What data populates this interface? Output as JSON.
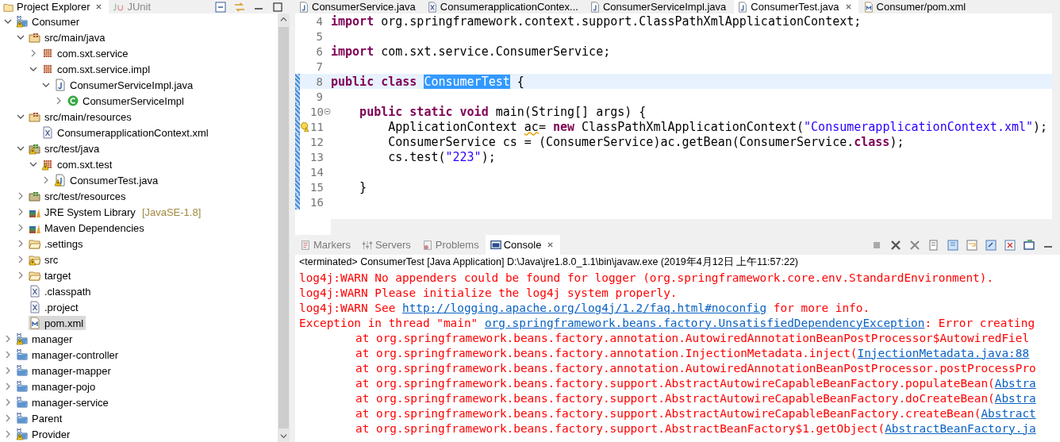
{
  "explorer": {
    "tabs": [
      {
        "label": "Project Explorer",
        "selected": true,
        "kind": "explorer"
      },
      {
        "label": "JUnit",
        "selected": false,
        "kind": "junit"
      }
    ],
    "tree": [
      {
        "label": "Consumer",
        "kind": "project",
        "expanded": true,
        "warning": true,
        "selected": false,
        "children": [
          {
            "label": "src/main/java",
            "kind": "source-folder",
            "expanded": true,
            "warning": false,
            "selected": false,
            "children": [
              {
                "label": "com.sxt.service",
                "kind": "package",
                "expanded": false,
                "warning": false,
                "selected": false
              },
              {
                "label": "com.sxt.service.impl",
                "kind": "package",
                "expanded": true,
                "warning": false,
                "selected": false,
                "children": [
                  {
                    "label": "ConsumerServiceImpl.java",
                    "kind": "java-file",
                    "expanded": true,
                    "warning": false,
                    "selected": false,
                    "children": [
                      {
                        "label": "ConsumerServiceImpl",
                        "kind": "class",
                        "expanded": false,
                        "warning": false,
                        "selected": false
                      }
                    ]
                  }
                ]
              }
            ]
          },
          {
            "label": "src/main/resources",
            "kind": "source-folder",
            "expanded": true,
            "warning": false,
            "selected": false,
            "children": [
              {
                "label": "ConsumerapplicationContext.xml",
                "kind": "xml-file",
                "warning": false,
                "selected": false
              }
            ]
          },
          {
            "label": "src/test/java",
            "kind": "test-folder",
            "expanded": true,
            "warning": true,
            "selected": false,
            "children": [
              {
                "label": "com.sxt.test",
                "kind": "package",
                "expanded": true,
                "warning": true,
                "selected": false,
                "children": [
                  {
                    "label": "ConsumerTest.java",
                    "kind": "java-file",
                    "expanded": false,
                    "warning": true,
                    "selected": false
                  }
                ]
              }
            ]
          },
          {
            "label": "src/test/resources",
            "kind": "test-folder",
            "expanded": false,
            "warning": false,
            "selected": false
          },
          {
            "label": "JRE System Library",
            "decoration": "[JavaSE-1.8]",
            "kind": "library",
            "expanded": false,
            "warning": false,
            "selected": false
          },
          {
            "label": "Maven Dependencies",
            "kind": "library",
            "expanded": false,
            "warning": false,
            "selected": false
          },
          {
            "label": ".settings",
            "kind": "folder",
            "expanded": false,
            "warning": false,
            "selected": false
          },
          {
            "label": "src",
            "kind": "folder",
            "expanded": false,
            "warning": true,
            "selected": false
          },
          {
            "label": "target",
            "kind": "folder",
            "expanded": false,
            "warning": false,
            "selected": false
          },
          {
            "label": ".classpath",
            "kind": "xml-file",
            "warning": false,
            "selected": false
          },
          {
            "label": ".project",
            "kind": "xml-file",
            "warning": false,
            "selected": false
          },
          {
            "label": "pom.xml",
            "kind": "maven-file",
            "warning": false,
            "selected": true
          }
        ]
      },
      {
        "label": "manager",
        "kind": "project",
        "expanded": false,
        "warning": true,
        "selected": false
      },
      {
        "label": "manager-controller",
        "kind": "project",
        "expanded": false,
        "warning": false,
        "selected": false
      },
      {
        "label": "manager-mapper",
        "kind": "project",
        "expanded": false,
        "warning": false,
        "selected": false
      },
      {
        "label": "manager-pojo",
        "kind": "project",
        "expanded": false,
        "warning": false,
        "selected": false
      },
      {
        "label": "manager-service",
        "kind": "project",
        "expanded": false,
        "warning": false,
        "selected": false
      },
      {
        "label": "Parent",
        "kind": "project",
        "expanded": false,
        "warning": false,
        "selected": false
      },
      {
        "label": "Provider",
        "kind": "project",
        "expanded": false,
        "warning": true,
        "selected": false
      }
    ]
  },
  "editor": {
    "tabs": [
      {
        "label": "ConsumerService.java",
        "kind": "java",
        "selected": false
      },
      {
        "label": "ConsumerapplicationContex...",
        "kind": "xml",
        "selected": false
      },
      {
        "label": "ConsumerServiceImpl.java",
        "kind": "java",
        "selected": false
      },
      {
        "label": "ConsumerTest.java",
        "kind": "java",
        "selected": true
      },
      {
        "label": "Consumer/pom.xml",
        "kind": "maven",
        "selected": false
      }
    ],
    "lines": [
      {
        "number": "4",
        "current": false,
        "changed": false,
        "tokens": [
          {
            "text": "import",
            "kind": "keyword"
          },
          {
            "text": " org.springframework.context.support.ClassPathXmlApplicationContext;",
            "kind": "plain"
          }
        ]
      },
      {
        "number": "5",
        "current": false,
        "changed": false
      },
      {
        "number": "6",
        "current": false,
        "changed": false,
        "tokens": [
          {
            "text": "import",
            "kind": "keyword"
          },
          {
            "text": " com.sxt.service.ConsumerService;",
            "kind": "plain"
          }
        ]
      },
      {
        "number": "7",
        "current": false,
        "changed": false
      },
      {
        "number": "8",
        "current": true,
        "changed": true,
        "tokens": [
          {
            "text": "public class ",
            "kind": "keyword"
          },
          {
            "text": "ConsumerTest",
            "kind": "selection"
          },
          {
            "text": " {",
            "kind": "plain"
          }
        ]
      },
      {
        "number": "9",
        "current": false,
        "changed": true
      },
      {
        "number": "10",
        "current": false,
        "changed": true,
        "fold": true,
        "tokens": [
          {
            "text": "    public static void",
            "kind": "keyword"
          },
          {
            "text": " main(String[] args) {",
            "kind": "plain"
          }
        ]
      },
      {
        "number": "11",
        "current": false,
        "changed": true,
        "warning": true,
        "tokens": [
          {
            "text": "        ApplicationContext ",
            "kind": "plain"
          },
          {
            "text": "ac",
            "kind": "warning"
          },
          {
            "text": "= ",
            "kind": "plain"
          },
          {
            "text": "new",
            "kind": "keyword"
          },
          {
            "text": " ClassPathXmlApplicationContext(",
            "kind": "plain"
          },
          {
            "text": "\"ConsumerapplicationContext.xml\"",
            "kind": "string"
          },
          {
            "text": ");",
            "kind": "plain"
          }
        ]
      },
      {
        "number": "12",
        "current": false,
        "changed": true,
        "tokens": [
          {
            "text": "        ConsumerService cs = (ConsumerService)ac.getBean(ConsumerService.",
            "kind": "plain"
          },
          {
            "text": "class",
            "kind": "keyword"
          },
          {
            "text": ");",
            "kind": "plain"
          }
        ]
      },
      {
        "number": "13",
        "current": false,
        "changed": true,
        "tokens": [
          {
            "text": "        cs.test(",
            "kind": "plain"
          },
          {
            "text": "\"223\"",
            "kind": "string"
          },
          {
            "text": ");",
            "kind": "plain"
          }
        ]
      },
      {
        "number": "14",
        "current": false,
        "changed": true
      },
      {
        "number": "15",
        "current": false,
        "changed": true,
        "tokens": [
          {
            "text": "    }",
            "kind": "plain"
          }
        ]
      },
      {
        "number": "16",
        "current": false,
        "changed": true
      }
    ]
  },
  "console": {
    "tabs": [
      {
        "label": "Markers",
        "kind": "markers",
        "selected": false
      },
      {
        "label": "Servers",
        "kind": "servers",
        "selected": false
      },
      {
        "label": "Problems",
        "kind": "problems",
        "selected": false
      },
      {
        "label": "Console",
        "kind": "console",
        "selected": true
      }
    ],
    "status": "<terminated> ConsumerTest [Java Application] D:\\Java\\jre1.8.0_1.1\\bin\\javaw.exe (2019年4月12日 上午11:57:22)",
    "lines": [
      {
        "kind": "error",
        "segments": [
          {
            "text": "log4j:WARN No appenders could be found for logger (org.springframework.core.env.StandardEnvironment).",
            "kind": "plain"
          }
        ]
      },
      {
        "kind": "error",
        "segments": [
          {
            "text": "log4j:WARN Please initialize the log4j system properly.",
            "kind": "plain"
          }
        ]
      },
      {
        "kind": "error",
        "segments": [
          {
            "text": "log4j:WARN See ",
            "kind": "plain"
          },
          {
            "text": "http://logging.apache.org/log4j/1.2/faq.html#noconfig",
            "kind": "link"
          },
          {
            "text": " for more info.",
            "kind": "plain"
          }
        ]
      },
      {
        "kind": "error",
        "segments": [
          {
            "text": "Exception in thread \"main\" ",
            "kind": "plain"
          },
          {
            "text": "org.springframework.beans.factory.UnsatisfiedDependencyException",
            "kind": "link"
          },
          {
            "text": ": Error creating",
            "kind": "plain"
          }
        ]
      },
      {
        "kind": "trace",
        "segments": [
          {
            "text": "at org.springframework.beans.factory.annotation.AutowiredAnnotationBeanPostProcessor$AutowiredFiel",
            "kind": "plain"
          }
        ]
      },
      {
        "kind": "trace",
        "segments": [
          {
            "text": "at org.springframework.beans.factory.annotation.InjectionMetadata.inject(",
            "kind": "plain"
          },
          {
            "text": "InjectionMetadata.java:88",
            "kind": "link"
          }
        ]
      },
      {
        "kind": "trace",
        "segments": [
          {
            "text": "at org.springframework.beans.factory.annotation.AutowiredAnnotationBeanPostProcessor.postProcessPro",
            "kind": "plain"
          }
        ]
      },
      {
        "kind": "trace",
        "segments": [
          {
            "text": "at org.springframework.beans.factory.support.AbstractAutowireCapableBeanFactory.populateBean(",
            "kind": "plain"
          },
          {
            "text": "Abstra",
            "kind": "link"
          }
        ]
      },
      {
        "kind": "trace",
        "segments": [
          {
            "text": "at org.springframework.beans.factory.support.AbstractAutowireCapableBeanFactory.doCreateBean(",
            "kind": "plain"
          },
          {
            "text": "Abstra",
            "kind": "link"
          }
        ]
      },
      {
        "kind": "trace",
        "segments": [
          {
            "text": "at org.springframework.beans.factory.support.AbstractAutowireCapableBeanFactory.createBean(",
            "kind": "plain"
          },
          {
            "text": "Abstract",
            "kind": "link"
          }
        ]
      },
      {
        "kind": "trace",
        "segments": [
          {
            "text": "at org.springframework.beans.factory.support.AbstractBeanFactory$1.getObject(",
            "kind": "plain"
          },
          {
            "text": "AbstractBeanFactory.ja",
            "kind": "link"
          }
        ]
      }
    ]
  }
}
